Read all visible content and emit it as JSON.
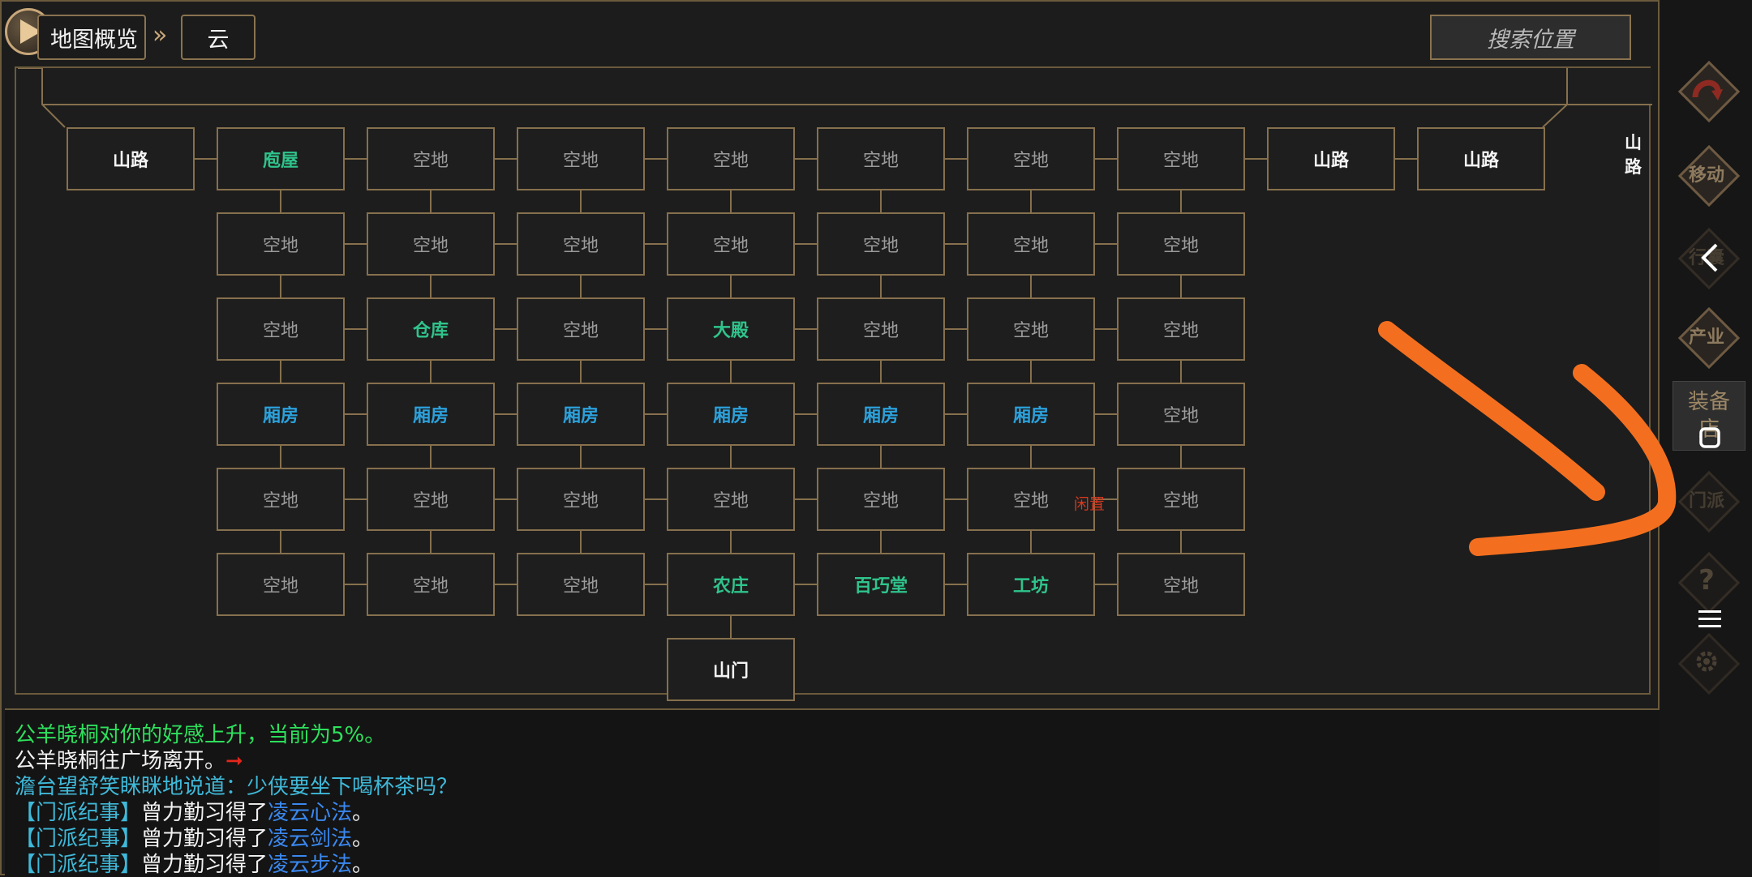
{
  "breadcrumb": {
    "overview_label": "地图概览",
    "current_label": "云"
  },
  "search": {
    "placeholder": "搜索位置"
  },
  "map": {
    "top_road_label": "山路",
    "rows": [
      [
        {
          "label": "山路",
          "kind": "road"
        },
        {
          "label": "庖屋",
          "kind": "building"
        },
        {
          "label": "空地",
          "kind": "empty"
        },
        {
          "label": "空地",
          "kind": "empty"
        },
        {
          "label": "空地",
          "kind": "empty"
        },
        {
          "label": "空地",
          "kind": "empty"
        },
        {
          "label": "空地",
          "kind": "empty"
        },
        {
          "label": "空地",
          "kind": "empty"
        },
        {
          "label": "山路",
          "kind": "road"
        },
        {
          "label": "山路",
          "kind": "road"
        }
      ],
      [
        {
          "label": "空地",
          "kind": "empty"
        },
        {
          "label": "空地",
          "kind": "empty"
        },
        {
          "label": "空地",
          "kind": "empty"
        },
        {
          "label": "空地",
          "kind": "empty"
        },
        {
          "label": "空地",
          "kind": "empty"
        },
        {
          "label": "空地",
          "kind": "empty"
        },
        {
          "label": "空地",
          "kind": "empty"
        }
      ],
      [
        {
          "label": "空地",
          "kind": "empty"
        },
        {
          "label": "仓库",
          "kind": "building"
        },
        {
          "label": "空地",
          "kind": "empty"
        },
        {
          "label": "大殿",
          "kind": "building"
        },
        {
          "label": "空地",
          "kind": "empty"
        },
        {
          "label": "空地",
          "kind": "empty"
        },
        {
          "label": "空地",
          "kind": "empty"
        }
      ],
      [
        {
          "label": "厢房",
          "kind": "room"
        },
        {
          "label": "厢房",
          "kind": "room"
        },
        {
          "label": "厢房",
          "kind": "room"
        },
        {
          "label": "厢房",
          "kind": "room"
        },
        {
          "label": "厢房",
          "kind": "room"
        },
        {
          "label": "厢房",
          "kind": "room"
        },
        {
          "label": "空地",
          "kind": "empty"
        }
      ],
      [
        {
          "label": "空地",
          "kind": "empty"
        },
        {
          "label": "空地",
          "kind": "empty"
        },
        {
          "label": "空地",
          "kind": "empty"
        },
        {
          "label": "空地",
          "kind": "empty"
        },
        {
          "label": "空地",
          "kind": "empty"
        },
        {
          "label": "空地",
          "kind": "empty"
        },
        {
          "label": "空地",
          "kind": "empty"
        }
      ],
      [
        {
          "label": "空地",
          "kind": "empty"
        },
        {
          "label": "空地",
          "kind": "empty"
        },
        {
          "label": "空地",
          "kind": "empty"
        },
        {
          "label": "农庄",
          "kind": "building"
        },
        {
          "label": "百巧堂",
          "kind": "building"
        },
        {
          "label": "工坊",
          "kind": "building"
        },
        {
          "label": "空地",
          "kind": "empty"
        }
      ],
      [
        {
          "label": "山门",
          "kind": "gate"
        }
      ]
    ],
    "idle_label": "闲置"
  },
  "log": {
    "lines": [
      [
        {
          "text": "公羊晓桐对你的好感上升，当前为5%。",
          "color": "green"
        }
      ],
      [
        {
          "text": "公羊晓桐往广场离开。",
          "color": "white"
        },
        {
          "text": "➞",
          "color": "red"
        }
      ],
      [
        {
          "text": "澹台望舒笑眯眯地说道：少侠要坐下喝杯茶吗？",
          "color": "cyan"
        }
      ],
      [
        {
          "text": "【门派纪事】",
          "color": "cyan"
        },
        {
          "text": "曾力勤习得了",
          "color": "white"
        },
        {
          "text": "凌云心法",
          "color": "blue"
        },
        {
          "text": "。",
          "color": "white"
        }
      ],
      [
        {
          "text": "【门派纪事】",
          "color": "cyan"
        },
        {
          "text": "曾力勤习得了",
          "color": "white"
        },
        {
          "text": "凌云剑法",
          "color": "blue"
        },
        {
          "text": "。",
          "color": "white"
        }
      ],
      [
        {
          "text": "【门派纪事】",
          "color": "cyan"
        },
        {
          "text": "曾力勤习得了",
          "color": "white"
        },
        {
          "text": "凌云步法",
          "color": "blue"
        },
        {
          "text": "。",
          "color": "white"
        }
      ]
    ]
  },
  "sidebar": {
    "move_label": "移动",
    "bag_label": "行囊",
    "industry_label": "产业",
    "equip_shop_label": [
      "装备",
      "店"
    ],
    "sect_label": "门派",
    "help_label": "?"
  },
  "colors": {
    "gold_border": "#86704d",
    "building_text": "#2fc48c",
    "room_text": "#2ba2dd",
    "idle_text": "#d4391f",
    "annotation_stroke": "#f36f1f"
  }
}
